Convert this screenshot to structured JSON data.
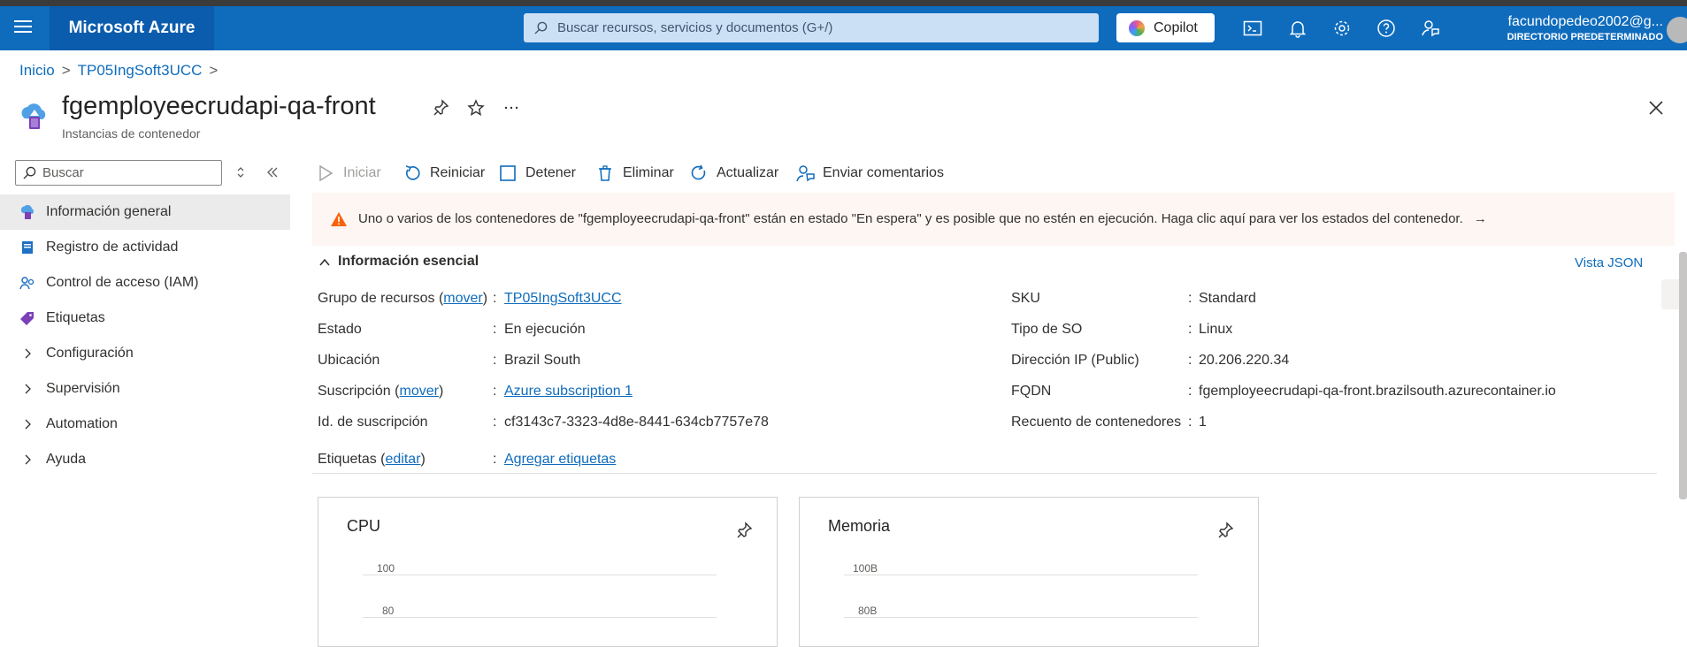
{
  "topbar": {
    "brand": "Microsoft Azure",
    "search_placeholder": "Buscar recursos, servicios y documentos (G+/)",
    "copilot_label": "Copilot",
    "user_name": "facundopedeo2002@g...",
    "user_directory": "DIRECTORIO PREDETERMINADO",
    "icons": [
      "cloud-shell-icon",
      "bell-icon",
      "gear-icon",
      "help-icon",
      "feedback-icon"
    ]
  },
  "breadcrumb": {
    "home": "Inicio",
    "group": "TP05IngSoft3UCC"
  },
  "resource": {
    "title": "fgemployeecrudapi-qa-front",
    "subtitle": "Instancias de contenedor"
  },
  "sidebar": {
    "search_placeholder": "Buscar",
    "items": [
      {
        "label": "Información general",
        "icon": "overview-icon",
        "active": true
      },
      {
        "label": "Registro de actividad",
        "icon": "activity-log-icon"
      },
      {
        "label": "Control de acceso (IAM)",
        "icon": "iam-icon"
      },
      {
        "label": "Etiquetas",
        "icon": "tag-icon"
      },
      {
        "label": "Configuración",
        "icon": "chevron-right-icon"
      },
      {
        "label": "Supervisión",
        "icon": "chevron-right-icon"
      },
      {
        "label": "Automation",
        "icon": "chevron-right-icon"
      },
      {
        "label": "Ayuda",
        "icon": "chevron-right-icon"
      }
    ]
  },
  "toolbar": {
    "start": "Iniciar",
    "restart": "Reiniciar",
    "stop": "Detener",
    "delete": "Eliminar",
    "refresh": "Actualizar",
    "feedback": "Enviar comentarios"
  },
  "banner": {
    "text": "Uno o varios de los contenedores de \"fgemployeecrudapi-qa-front\" están en estado \"En espera\" y es posible que no estén en ejecución. Haga clic aquí para ver los estados del contenedor.",
    "arrow": "→",
    "color": "#f7630c"
  },
  "essentials": {
    "heading": "Información esencial",
    "json_view": "Vista JSON",
    "left": {
      "resource_group_label": "Grupo de recursos",
      "move_link": "mover",
      "resource_group_value": "TP05IngSoft3UCC",
      "status_label": "Estado",
      "status_value": "En ejecución",
      "location_label": "Ubicación",
      "location_value": "Brazil South",
      "subscription_label": "Suscripción",
      "subscription_value": "Azure subscription 1",
      "subscription_id_label": "Id. de suscripción",
      "subscription_id_value": "cf3143c7-3323-4d8e-8441-634cb7757e78",
      "tags_label": "Etiquetas",
      "edit_link": "editar",
      "tags_value": "Agregar etiquetas"
    },
    "right": {
      "sku_label": "SKU",
      "sku_value": "Standard",
      "os_label": "Tipo de SO",
      "os_value": "Linux",
      "ip_label": "Dirección IP (Public)",
      "ip_value": "20.206.220.34",
      "fqdn_label": "FQDN",
      "fqdn_value": "fgemployeecrudapi-qa-front.brazilsouth.azurecontainer.io",
      "count_label": "Recuento de contenedores",
      "count_value": "1"
    }
  },
  "tiles": {
    "cpu": {
      "title": "CPU",
      "ticks": [
        "100",
        "80"
      ]
    },
    "memory": {
      "title": "Memoria",
      "ticks": [
        "100B",
        "80B"
      ]
    }
  },
  "colors": {
    "accent": "#0f6cbd",
    "topbar": "#0f6cbd",
    "warning": "#f7630c"
  }
}
